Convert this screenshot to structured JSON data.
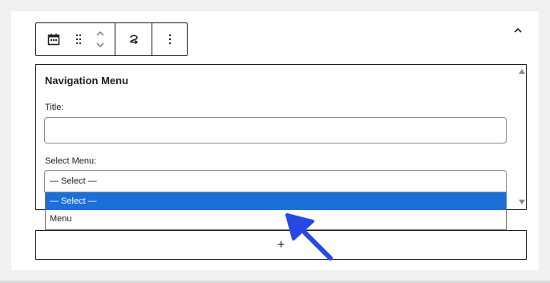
{
  "widget": {
    "title": "Navigation Menu",
    "title_label": "Title:",
    "title_value": "",
    "select_label": "Select Menu:",
    "select_value": "— Select —"
  },
  "dropdown": {
    "options": [
      {
        "label": "— Select —",
        "selected": true
      },
      {
        "label": "Menu",
        "selected": false
      }
    ]
  },
  "toolbar": {
    "icons": [
      "calendar-icon",
      "drag-handle-icon",
      "move-up-down-icon",
      "transform-icon",
      "more-options-icon"
    ]
  },
  "add_block": {
    "label": "+"
  },
  "colors": {
    "highlight": "#1d6fd8",
    "annotation_arrow": "#2748e4"
  }
}
